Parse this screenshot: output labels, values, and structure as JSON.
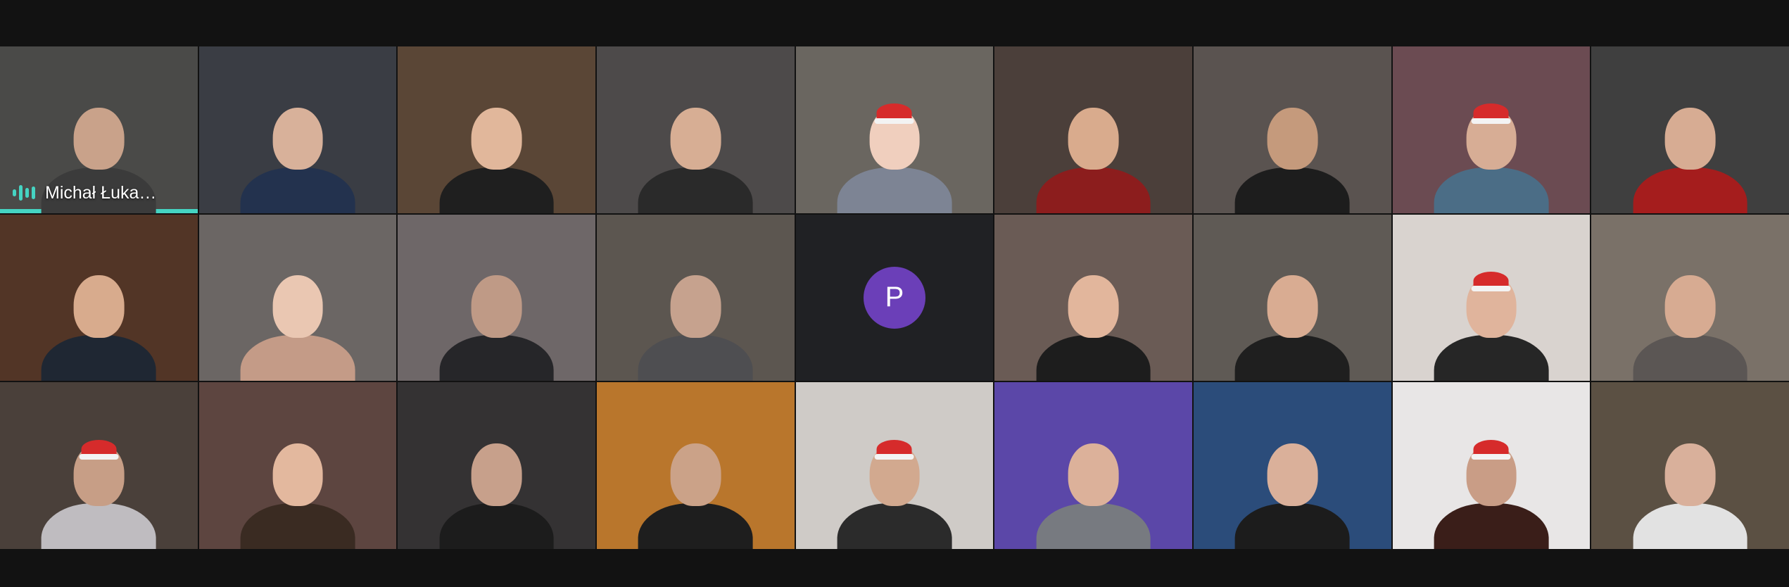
{
  "meeting": {
    "active_speaker_name": "Michał Łuka…",
    "placeholder_initial": "P",
    "placeholder_color": "#6b3fb8",
    "speaking_accent": "#45d4c2"
  },
  "tiles": [
    {
      "bg": "#4a4a48",
      "body": "#3b3b3b",
      "skin": "#c9a28a",
      "hat": false
    },
    {
      "bg": "#3a3d44",
      "body": "#23324e",
      "skin": "#d8b19a",
      "hat": false
    },
    {
      "bg": "#5a4636",
      "body": "#1f1f1f",
      "skin": "#e1b79b",
      "hat": false
    },
    {
      "bg": "#4d4a4a",
      "body": "#2a2a2a",
      "skin": "#d7ae94",
      "hat": false
    },
    {
      "bg": "#6a6660",
      "body": "#7d8494",
      "skin": "#f0cfbe",
      "hat": true
    },
    {
      "bg": "#4b3f3a",
      "body": "#8c1d1d",
      "skin": "#d9ab8d",
      "hat": false
    },
    {
      "bg": "#5a5350",
      "body": "#1d1d1d",
      "skin": "#c59a7c",
      "hat": false
    },
    {
      "bg": "#6b4b52",
      "body": "#4b6d86",
      "skin": "#d7ad95",
      "hat": true
    },
    {
      "bg": "#3f3f3f",
      "body": "#a51d1d",
      "skin": "#d7ac93",
      "hat": false
    },
    {
      "bg": "#523526",
      "body": "#1f2733",
      "skin": "#d8ab8d",
      "hat": false
    },
    {
      "bg": "#6b6664",
      "body": "#c49b87",
      "skin": "#eac7b2",
      "hat": false
    },
    {
      "bg": "#6e6768",
      "body": "#262629",
      "skin": "#bf9a86",
      "hat": false
    },
    {
      "bg": "#5c5650",
      "body": "#4e4e51",
      "skin": "#c6a28e",
      "hat": false
    },
    {
      "bg": "#202124",
      "placeholder": true
    },
    {
      "bg": "#6a5b55",
      "body": "#1d1d1d",
      "skin": "#e2b69c",
      "hat": false
    },
    {
      "bg": "#5f5a55",
      "body": "#1f1f1f",
      "skin": "#d9ac92",
      "hat": false
    },
    {
      "bg": "#d9d3cf",
      "body": "#262626",
      "skin": "#e0b49c",
      "hat": true
    },
    {
      "bg": "#7a7168",
      "body": "#5b5654",
      "skin": "#d7ab92",
      "hat": false
    },
    {
      "bg": "#4a403a",
      "body": "#bfbcc0",
      "skin": "#c79e86",
      "hat": true
    },
    {
      "bg": "#5d4540",
      "body": "#3a2b22",
      "skin": "#e3b89e",
      "hat": false
    },
    {
      "bg": "#343233",
      "body": "#1c1c1c",
      "skin": "#c7a08b",
      "hat": false
    },
    {
      "bg": "#b9762c",
      "body": "#1e1e1e",
      "skin": "#cba288",
      "hat": false
    },
    {
      "bg": "#cfcbc7",
      "body": "#2b2b2b",
      "skin": "#d2a98f",
      "hat": true
    },
    {
      "bg": "#5b47a8",
      "body": "#777a80",
      "skin": "#dcb19a",
      "hat": false
    },
    {
      "bg": "#2b4c7a",
      "body": "#1c1c1c",
      "skin": "#dab09a",
      "hat": false
    },
    {
      "bg": "#e8e6e6",
      "body": "#3a1e19",
      "skin": "#c99d86",
      "hat": true
    },
    {
      "bg": "#5b5043",
      "body": "#e2e2e2",
      "skin": "#d9b09b",
      "hat": false
    }
  ]
}
